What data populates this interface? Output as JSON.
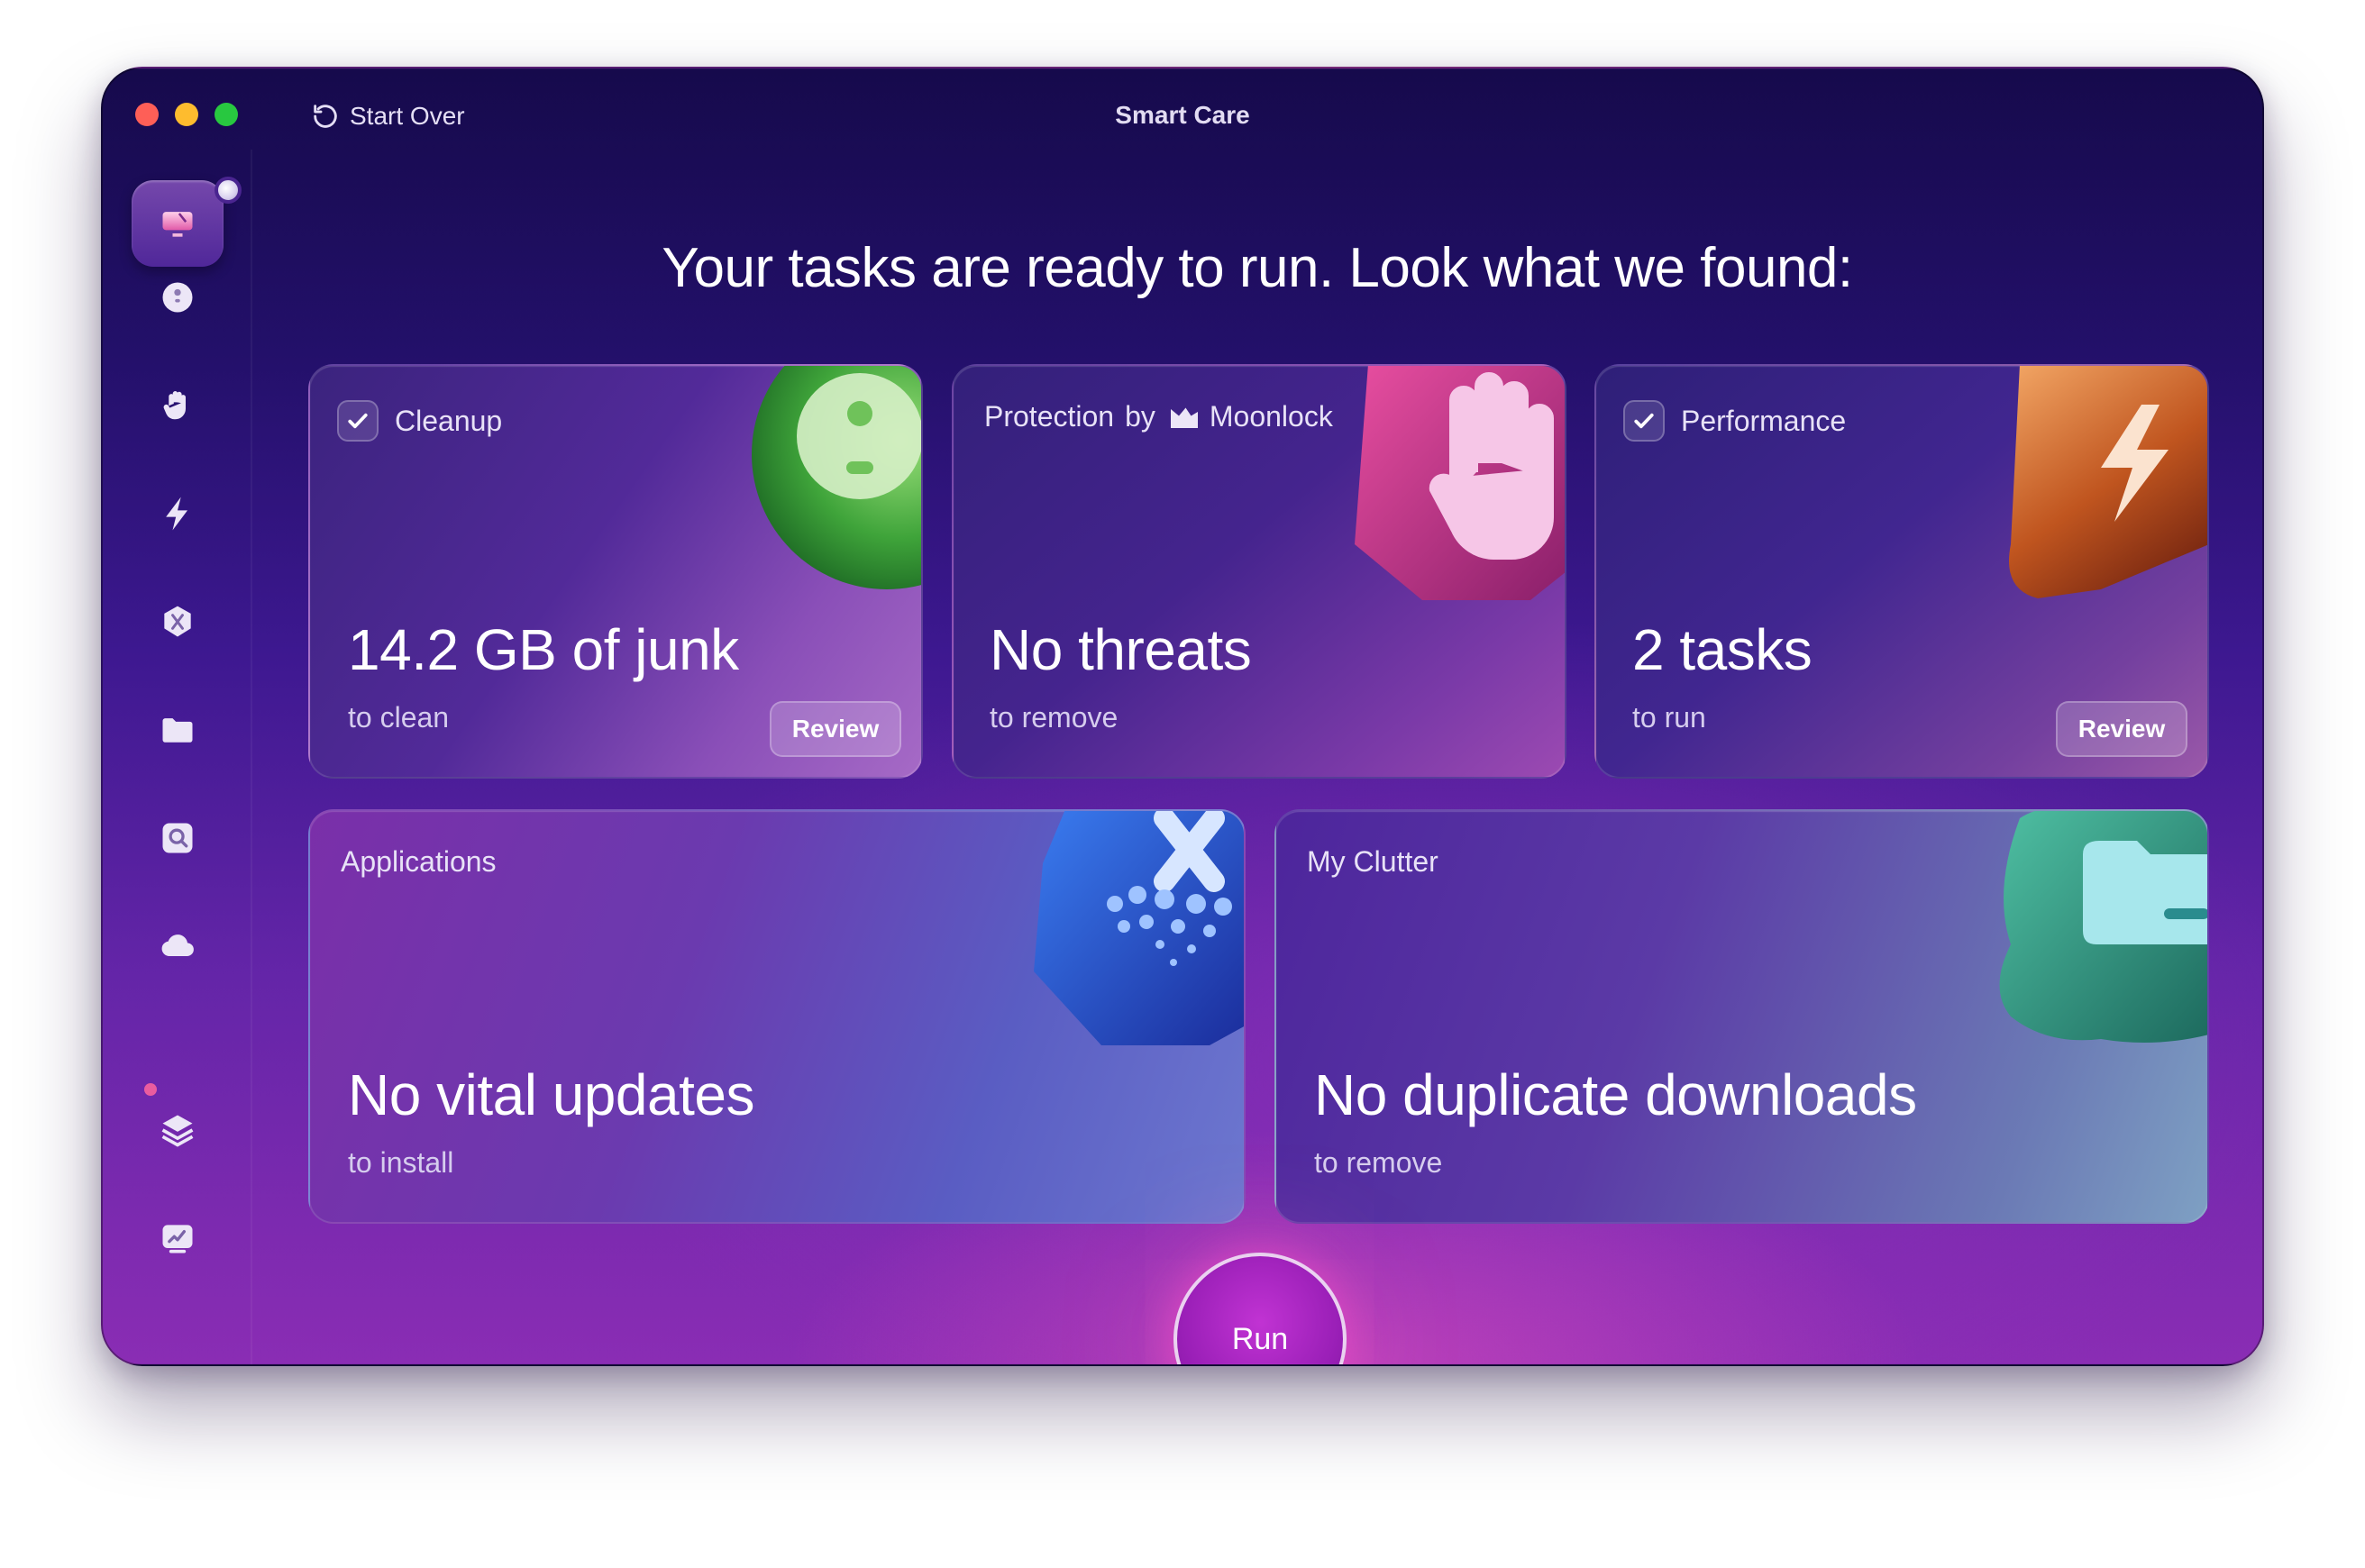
{
  "window": {
    "title": "Smart Care",
    "start_over_label": "Start Over"
  },
  "headline": "Your tasks are ready to run. Look what we found:",
  "sidebar": {
    "items": [
      {
        "icon": "smart-care-icon",
        "active": true
      },
      {
        "icon": "cleanup-icon"
      },
      {
        "icon": "protection-hand-icon"
      },
      {
        "icon": "performance-bolt-icon"
      },
      {
        "icon": "applications-icon"
      },
      {
        "icon": "my-clutter-folder-icon"
      },
      {
        "icon": "space-lens-icon"
      },
      {
        "icon": "cloud-icon"
      },
      {
        "icon": "updater-stack-icon"
      },
      {
        "icon": "assistant-chart-icon"
      }
    ]
  },
  "cards": {
    "cleanup": {
      "label": "Cleanup",
      "checked": true,
      "value": "14.2 GB of junk",
      "sub": "to clean",
      "button": "Review"
    },
    "protection": {
      "label": "Protection",
      "by": "by",
      "brand": "Moonlock",
      "value": "No threats",
      "sub": "to remove"
    },
    "performance": {
      "label": "Performance",
      "checked": true,
      "value": "2 tasks",
      "sub": "to run",
      "button": "Review"
    },
    "applications": {
      "label": "Applications",
      "value": "No vital updates",
      "sub": "to install"
    },
    "clutter": {
      "label": "My Clutter",
      "value": "No duplicate downloads",
      "sub": "to remove"
    }
  },
  "run_button": "Run",
  "colors": {
    "accent": "#c133d3",
    "traffic_red": "#fe5f57",
    "traffic_yellow": "#febc2e",
    "traffic_green": "#28c840"
  }
}
